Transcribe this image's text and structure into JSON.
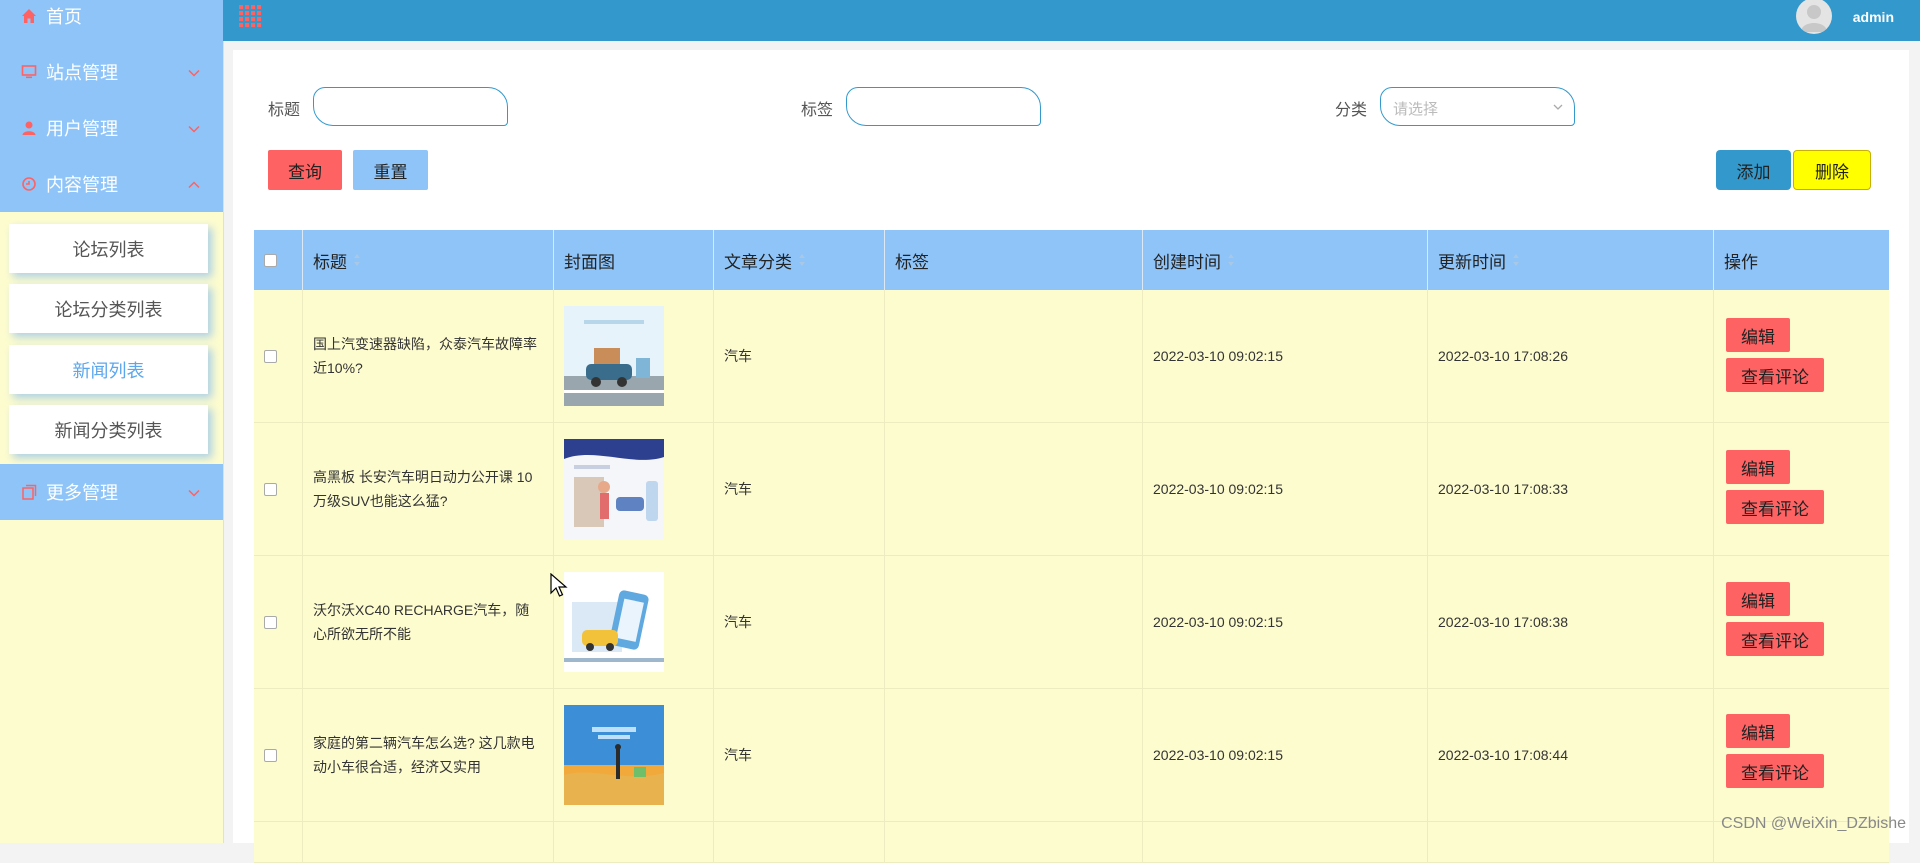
{
  "sidebar": {
    "items": [
      {
        "label": "首页",
        "icon": "home-icon"
      },
      {
        "label": "站点管理",
        "icon": "monitor-icon"
      },
      {
        "label": "用户管理",
        "icon": "user-icon"
      },
      {
        "label": "内容管理",
        "icon": "content-icon"
      },
      {
        "label": "更多管理",
        "icon": "more-icon"
      }
    ],
    "submenu": [
      "论坛列表",
      "论坛分类列表",
      "新闻列表",
      "新闻分类列表"
    ],
    "active_submenu": "新闻列表"
  },
  "header": {
    "user": "admin"
  },
  "filters": {
    "title_label": "标题",
    "tag_label": "标签",
    "category_label": "分类",
    "category_placeholder": "请选择",
    "query_button": "查询",
    "reset_button": "重置",
    "add_button": "添加",
    "delete_button": "删除"
  },
  "table": {
    "columns": [
      "标题",
      "封面图",
      "文章分类",
      "标签",
      "创建时间",
      "更新时间",
      "操作"
    ],
    "rows": [
      {
        "title": "国上汽变速器缺陷，众泰汽车故障率近10%?",
        "category": "汽车",
        "tag": "",
        "created": "2022-03-10 09:02:15",
        "updated": "2022-03-10 17:08:26"
      },
      {
        "title": "高黑板 长安汽车明日动力公开课 10万级SUV也能这么猛?",
        "category": "汽车",
        "tag": "",
        "created": "2022-03-10 09:02:15",
        "updated": "2022-03-10 17:08:33"
      },
      {
        "title": "沃尔沃XC40 RECHARGE汽车，随心所欲无所不能",
        "category": "汽车",
        "tag": "",
        "created": "2022-03-10 09:02:15",
        "updated": "2022-03-10 17:08:38"
      },
      {
        "title": "家庭的第二辆汽车怎么选? 这几款电动小车很合适，经济又实用",
        "category": "汽车",
        "tag": "",
        "created": "2022-03-10 09:02:15",
        "updated": "2022-03-10 17:08:44"
      }
    ],
    "edit_button": "编辑",
    "comments_button": "查看评论"
  },
  "watermark": "CSDN @WeiXin_DZbishe",
  "colors": {
    "topbar": "#3399cc",
    "menu": "#8fc4f9",
    "sidebar_bg": "#fdfccf",
    "row_bg": "#fdfccf",
    "action_button": "#fe6263",
    "delete_button": "#ffff00"
  }
}
